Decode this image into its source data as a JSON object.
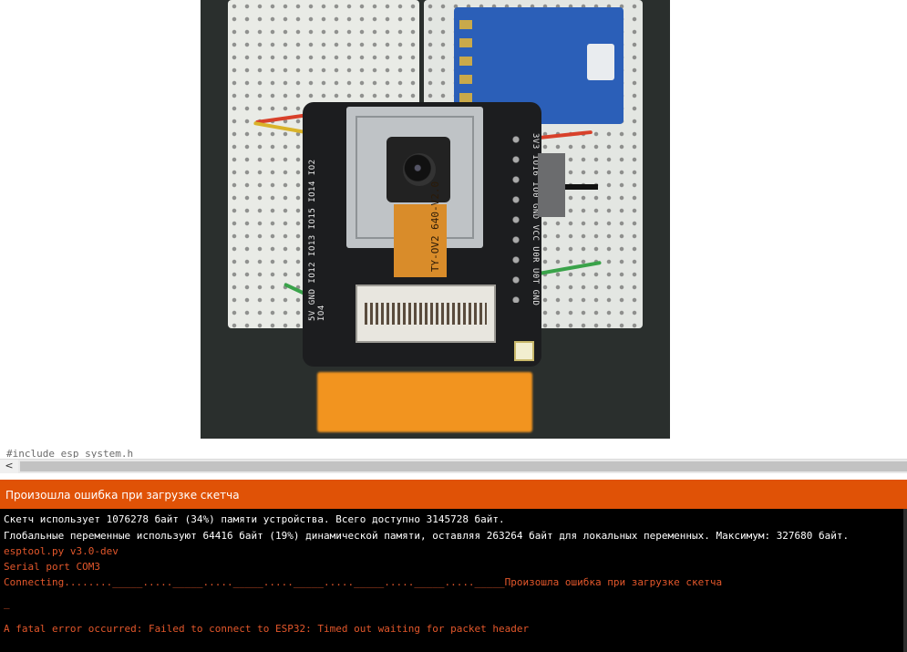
{
  "photo": {
    "flex_label": "TY-OV2 640-V2.0",
    "pin_labels_right": "3V3 IO16 IO0 GND VCC U0R U0T GND",
    "pin_labels_left": "5V GND IO12 IO13 IO15 IO14 IO2 IO4"
  },
  "editor": {
    "code_line": "#include  esp_system.h",
    "scroll_left_glyph": "<"
  },
  "status_bar": {
    "message": "Произошла ошибка при загрузке скетча",
    "color": "#e05206"
  },
  "console": {
    "lines": [
      "Скетч использует 1076278 байт (34%) памяти устройства. Всего доступно 3145728 байт.",
      "Глобальные переменные используют 64416 байт (19%) динамической памяти, оставляя 263264 байт для локальных переменных. Максимум: 327680 байт.",
      "esptool.py v3.0-dev",
      "Serial port COM3",
      "Connecting........_____....._____....._____....._____....._____....._____....._____Произошла ошибка при загрузке скетча",
      "_",
      "A fatal error occurred: Failed to connect to ESP32: Timed out waiting for packet header"
    ],
    "text_color": "#ffffff",
    "error_color": "#e3572b"
  }
}
